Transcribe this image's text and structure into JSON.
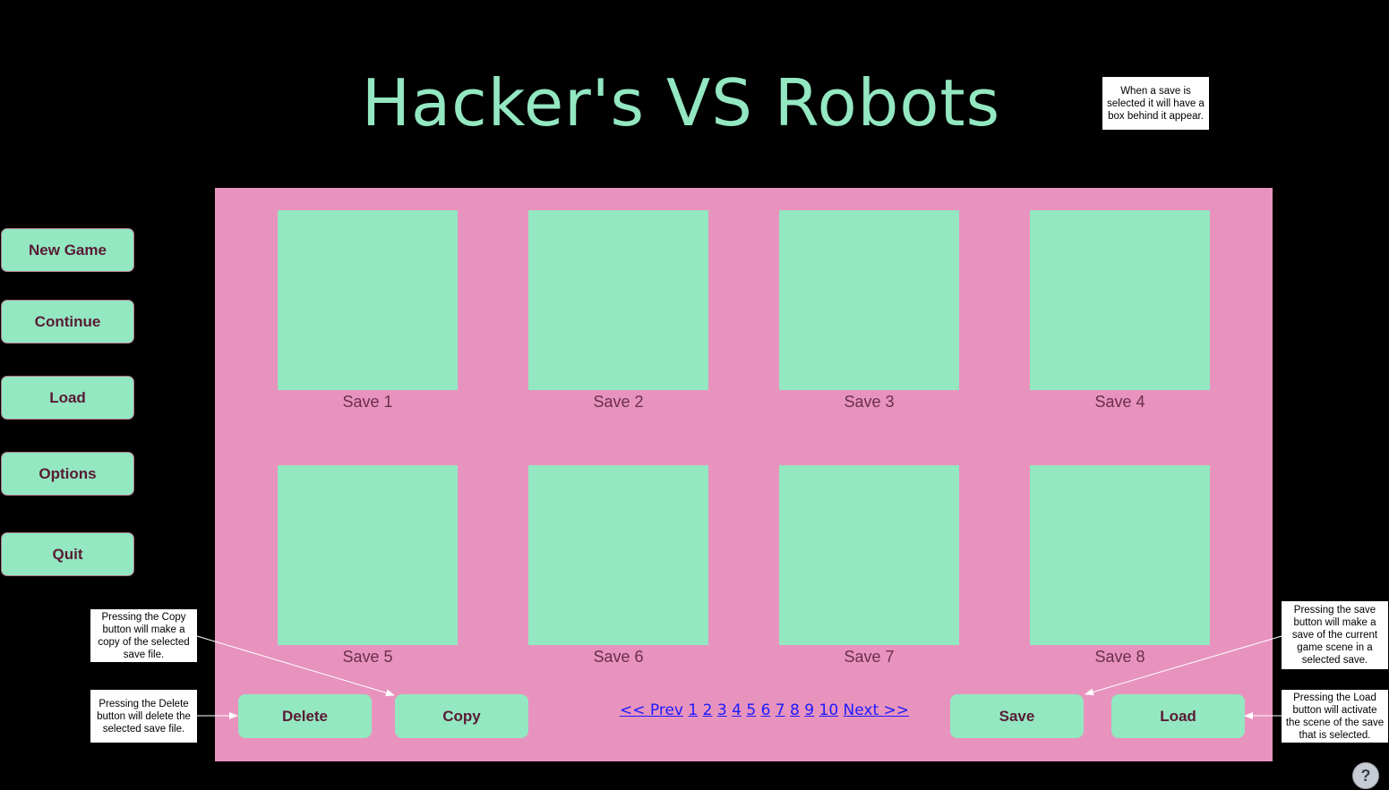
{
  "title": "Hacker's VS Robots",
  "menu": {
    "new_game": "New Game",
    "continue": "Continue",
    "load": "Load",
    "options": "Options",
    "quit": "Quit"
  },
  "saves": [
    {
      "label": "Save 1"
    },
    {
      "label": "Save 2"
    },
    {
      "label": "Save 3"
    },
    {
      "label": "Save 4"
    },
    {
      "label": "Save 5"
    },
    {
      "label": "Save 6"
    },
    {
      "label": "Save 7"
    },
    {
      "label": "Save 8"
    }
  ],
  "actions": {
    "delete": "Delete",
    "copy": "Copy",
    "save": "Save",
    "load": "Load"
  },
  "pagination": {
    "prev": "<< Prev",
    "pages": [
      "1",
      "2",
      "3",
      "4",
      "5",
      "6",
      "7",
      "8",
      "9",
      "10"
    ],
    "next": "Next >>"
  },
  "notes": {
    "selected": "When a save is selected it will have a box behind it appear.",
    "copy": "Pressing the Copy button will make a copy of the selected save file.",
    "delete": "Pressing the Delete button will delete the selected save file.",
    "save": "Pressing the save button will make a save of the current game scene in a selected save.",
    "load": "Pressing the Load button will activate the scene of the save that is selected."
  },
  "help": "?",
  "colors": {
    "background": "#000000",
    "accent_green": "#93e7c1",
    "panel_pink": "#e893be",
    "button_text": "#5a1a35",
    "link_blue": "#1a1aff"
  },
  "icons": {
    "help": "help-icon"
  }
}
